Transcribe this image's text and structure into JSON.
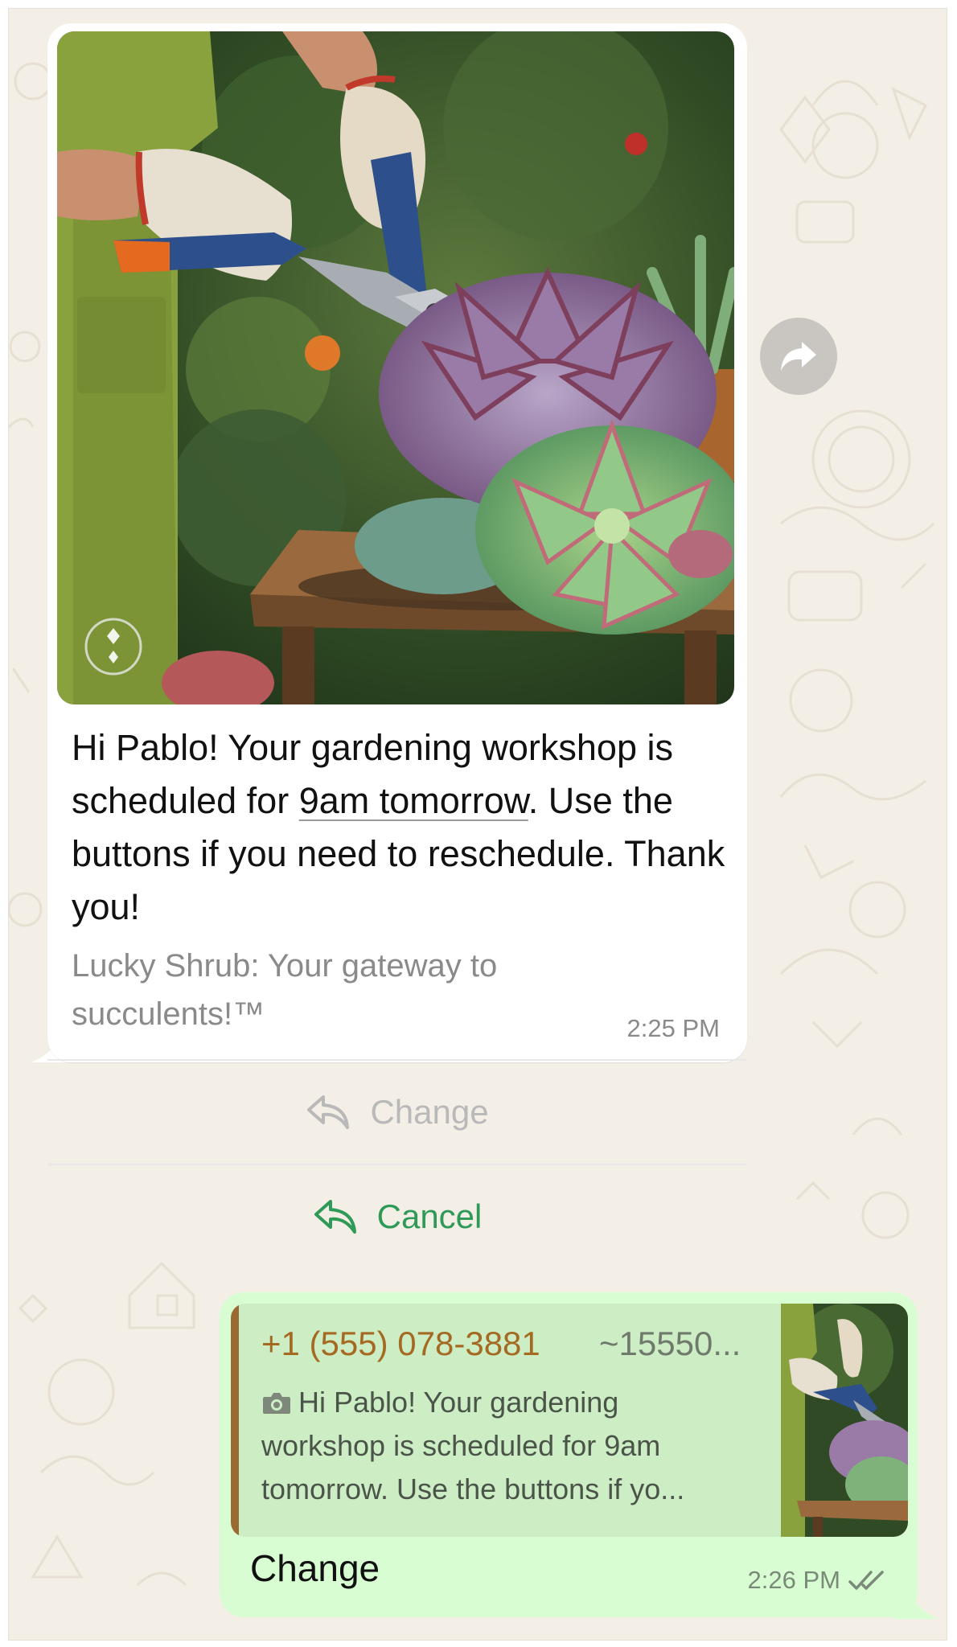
{
  "incoming": {
    "body_before_link": "Hi Pablo! Your gardening workshop is scheduled for ",
    "body_link": "9am tomorrow",
    "body_after_link": ". Use the buttons if you need to reschedule. Thank you!",
    "footer": "Lucky Shrub: Your gateway to succulents!™",
    "time": "2:25 PM",
    "media_icon": "gardening-photo",
    "buttons": [
      {
        "label": "Change",
        "icon": "reply-icon",
        "color": "#b9b9b9"
      },
      {
        "label": "Cancel",
        "icon": "reply-icon",
        "color": "#2f9a57"
      }
    ]
  },
  "forward_icon": "share-forward-icon",
  "outgoing": {
    "quote": {
      "sender": "+1 (555) 078-3881",
      "alias": "~15550...",
      "text": "Hi Pablo! Your gardening\nworkshop is scheduled for 9am\ntomorrow. Use the buttons if yo...",
      "icon": "camera-icon"
    },
    "text": "Change",
    "time": "2:26 PM",
    "status_icon": "double-check-icon"
  },
  "colors": {
    "wallpaper": "#f4efe6",
    "incoming_bubble": "#ffffff",
    "outgoing_bubble": "#d9fdd3",
    "accent_green": "#2f9a57",
    "quote_name": "#a56a22"
  }
}
